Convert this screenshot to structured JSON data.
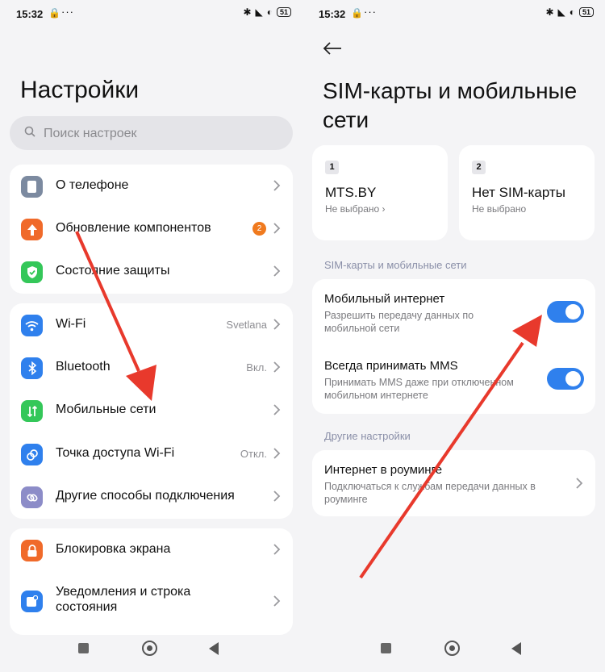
{
  "status_bar": {
    "time": "15:32",
    "dots": "···",
    "battery": "51"
  },
  "left": {
    "title": "Настройки",
    "search": {
      "placeholder": "Поиск настроек"
    },
    "group1": [
      {
        "label": "О телефоне",
        "icon": "phone-icon",
        "color": "#7c8aa0"
      },
      {
        "label": "Обновление компонентов",
        "icon": "upload-icon",
        "color": "#f06a2a",
        "badge": "2"
      },
      {
        "label": "Состояние защиты",
        "icon": "shield-check-icon",
        "color": "#34c759"
      }
    ],
    "group2": [
      {
        "label": "Wi-Fi",
        "value": "Svetlana",
        "icon": "wifi-icon",
        "color": "#2f80ed"
      },
      {
        "label": "Bluetooth",
        "value": "Вкл.",
        "icon": "bluetooth-icon",
        "color": "#2f80ed"
      },
      {
        "label": "Мобильные сети",
        "value": "",
        "icon": "mobile-data-icon",
        "color": "#34c759"
      },
      {
        "label": "Точка доступа Wi-Fi",
        "value": "Откл.",
        "icon": "hotspot-icon",
        "color": "#2f80ed"
      },
      {
        "label": "Другие способы подключения",
        "value": "",
        "icon": "link-icon",
        "color": "#8c8cc8"
      }
    ],
    "group3": [
      {
        "label": "Блокировка экрана",
        "icon": "lock-icon",
        "color": "#f06a2a"
      },
      {
        "label": "Уведомления и строка",
        "label2": "состояния",
        "icon": "notification-icon",
        "color": "#2f80ed"
      }
    ]
  },
  "right": {
    "title": "SIM-карты и мобильные сети",
    "sim1": {
      "num": "1",
      "name": "MTS.BY",
      "sub": "Не выбрано"
    },
    "sim2": {
      "num": "2",
      "name": "Нет SIM-карты",
      "sub": "Не выбрано"
    },
    "section1": "SIM-карты и мобильные сети",
    "mobile_internet": {
      "title": "Мобильный интернет",
      "desc": "Разрешить передачу данных по мобильной сети",
      "on": true
    },
    "mms": {
      "title": "Всегда принимать MMS",
      "desc": "Принимать MMS даже при отключенном мобильном интернете",
      "on": true
    },
    "section2": "Другие настройки",
    "roaming": {
      "title": "Интернет в роуминге",
      "desc": "Подключаться к службам передачи данных в роуминге"
    }
  },
  "colors": {
    "accent": "#2f80ed",
    "arrow": "#e8392c",
    "background": "#f4f4f6"
  }
}
